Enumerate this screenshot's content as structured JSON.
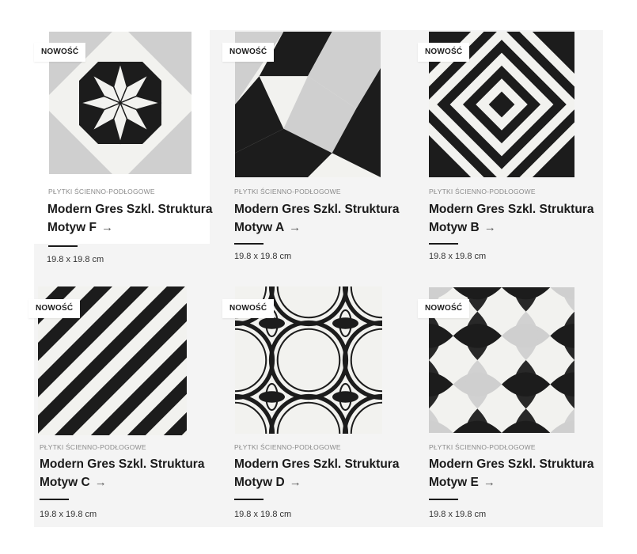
{
  "badge_label": "NOWOŚĆ",
  "colors": {
    "black": "#1c1c1c",
    "grey": "#cfcfcf",
    "white": "#f2f2ef"
  },
  "products": [
    {
      "pattern": "octagon-star",
      "category": "PŁYTKI ŚCIENNO-PODŁOGOWE",
      "title_line1": "Modern Gres Szkl. Struktura",
      "title_line2": "Motyw F",
      "arrow": "→",
      "size": "19.8 x 19.8 cm"
    },
    {
      "pattern": "cubes",
      "category": "PŁYTKI ŚCIENNO-PODŁOGOWE",
      "title_line1": "Modern Gres Szkl. Struktura",
      "title_line2": "Motyw A",
      "arrow": "→",
      "size": "19.8 x 19.8 cm"
    },
    {
      "pattern": "concentric-diamonds",
      "category": "PŁYTKI ŚCIENNO-PODŁOGOWE",
      "title_line1": "Modern Gres Szkl. Struktura",
      "title_line2": "Motyw B",
      "arrow": "→",
      "size": "19.8 x 19.8 cm"
    },
    {
      "pattern": "diagonal-stripes",
      "category": "PŁYTKI ŚCIENNO-PODŁOGOWE",
      "title_line1": "Modern Gres Szkl. Struktura",
      "title_line2": "Motyw C",
      "arrow": "→",
      "size": "19.8 x 19.8 cm"
    },
    {
      "pattern": "circle-outlines",
      "category": "PŁYTKI ŚCIENNO-PODŁOGOWE",
      "title_line1": "Modern Gres Szkl. Struktura",
      "title_line2": "Motyw D",
      "arrow": "→",
      "size": "19.8 x 19.8 cm"
    },
    {
      "pattern": "petal-flowers",
      "category": "PŁYTKI ŚCIENNO-PODŁOGOWE",
      "title_line1": "Modern Gres Szkl. Struktura",
      "title_line2": "Motyw E",
      "arrow": "→",
      "size": "19.8 x 19.8 cm"
    }
  ]
}
